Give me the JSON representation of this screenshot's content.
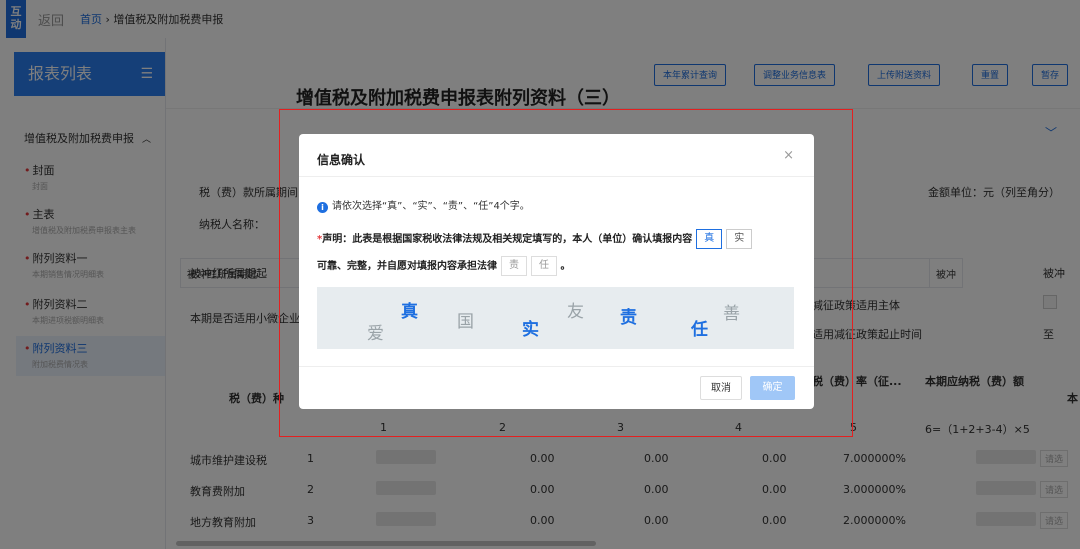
{
  "topbar": {
    "logo": "互\n动",
    "back": "返回",
    "home": "首页",
    "sep": "›",
    "current": "增值税及附加税费申报"
  },
  "sidebar": {
    "title": "报表列表",
    "group": "增值税及附加税费申报",
    "items": [
      {
        "title": "封面",
        "sub": "封面"
      },
      {
        "title": "主表",
        "sub": "增值税及附加税费申报表主表"
      },
      {
        "title": "附列资料一",
        "sub": "本期销售情况明细表"
      },
      {
        "title": "附列资料二",
        "sub": "本期进项税额明细表"
      },
      {
        "title": "附列资料三",
        "sub": "附加税费情况表"
      }
    ]
  },
  "toolbar": {
    "buttons": [
      "本年累计查询",
      "调整业务信息表",
      "上传附送资料",
      "重置",
      "暂存"
    ]
  },
  "doc": {
    "title": "增值税及附加税费申报表附列资料（三）",
    "period_label": "税（费）款所属期间:",
    "taxpayer_label": "纳税人名称：",
    "unit": "金额单位：元（列至角分）"
  },
  "table": {
    "row1": {
      "c1": "被冲红所属期起",
      "c2": "被冲"
    },
    "row2": {
      "c1": "本期是否适用小微企业",
      "c2": "减征政策适用主体",
      "c3": "适用减征政策起止时间",
      "c4": "至"
    },
    "header": {
      "c1": "税（费）种",
      "c2": "税（费）率（征...",
      "c3": "本期应纳税（费）额",
      "c4": "本"
    },
    "colnums": [
      "1",
      "2",
      "3",
      "4",
      "5",
      "6=（1+2+3-4）×5"
    ],
    "rows": [
      {
        "name": "城市维护建设税",
        "idx": "1",
        "v2": "0.00",
        "v3": "0.00",
        "v4": "0.00",
        "rate": "7.000000%",
        "btn": "请选"
      },
      {
        "name": "教育费附加",
        "idx": "2",
        "v2": "0.00",
        "v3": "0.00",
        "v4": "0.00",
        "rate": "3.000000%",
        "btn": "请选"
      },
      {
        "name": "地方教育附加",
        "idx": "3",
        "v2": "0.00",
        "v3": "0.00",
        "v4": "0.00",
        "rate": "2.000000%",
        "btn": "请选"
      }
    ]
  },
  "modal": {
    "title": "信息确认",
    "close": "×",
    "tip": "请依次选择“真”、“实”、“责”、“任”4个字。",
    "decl_req": "*",
    "decl_line1": "声明：此表是根据国家税收法律法规及相关规定填写的，本人（单位）确认填报内容",
    "box1": "真",
    "box2": "实",
    "decl_line2": "可靠、完整，并自愿对填报内容承担法律",
    "box3": "责",
    "box4": "任",
    "period": "。",
    "captcha_chars": [
      {
        "ch": "爱",
        "color": "#9aa3a8"
      },
      {
        "ch": "真",
        "color": "#1e6fe0"
      },
      {
        "ch": "国",
        "color": "#9aa3a8"
      },
      {
        "ch": "实",
        "color": "#1e6fe0"
      },
      {
        "ch": "友",
        "color": "#9aa3a8"
      },
      {
        "ch": "责",
        "color": "#1e6fe0"
      },
      {
        "ch": "任",
        "color": "#1e6fe0"
      },
      {
        "ch": "善",
        "color": "#9aa3a8"
      }
    ],
    "cancel": "取消",
    "ok": "确定"
  }
}
